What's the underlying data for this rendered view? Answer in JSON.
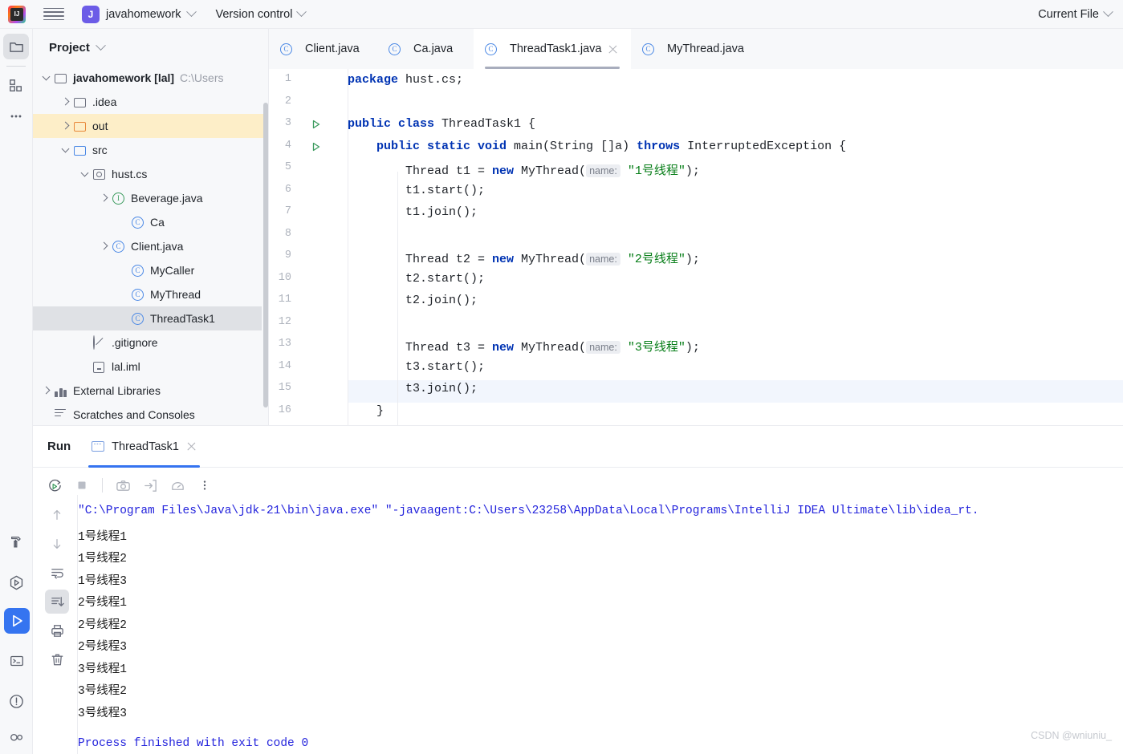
{
  "topbar": {
    "logo_alt": "IntelliJ IDEA",
    "project_initial": "J",
    "project_name": "javahomework",
    "version_control": "Version control",
    "current_file": "Current File"
  },
  "rail": {
    "top_items": [
      {
        "name": "project-tool-window",
        "icon": "folder-icon"
      },
      {
        "name": "commit-tool-window",
        "icon": "modules-icon"
      },
      {
        "name": "more-tool-windows",
        "icon": "ellipsis-icon"
      }
    ],
    "bottom_items": [
      {
        "name": "build-tool-window",
        "icon": "hammer-icon"
      },
      {
        "name": "services-tool-window",
        "icon": "run-anything-icon"
      },
      {
        "name": "run-tool-window",
        "icon": "play-icon"
      },
      {
        "name": "terminal-tool-window",
        "icon": "terminal-icon"
      },
      {
        "name": "problems-tool-window",
        "icon": "warning-icon"
      },
      {
        "name": "profiler-tool-window",
        "icon": "profiler-icon"
      }
    ]
  },
  "project_panel": {
    "title": "Project",
    "tree": [
      {
        "label": "javahomework [lal]",
        "path": "C:\\Users",
        "indent": 0,
        "arrow": "down",
        "icon": "project-folder-icon",
        "bold": true
      },
      {
        "label": ".idea",
        "indent": 1,
        "arrow": "right",
        "icon": "folder-icon"
      },
      {
        "label": "out",
        "indent": 1,
        "arrow": "right",
        "icon": "folder-orange-icon",
        "state": "hover"
      },
      {
        "label": "src",
        "indent": 1,
        "arrow": "down",
        "icon": "folder-blue-icon"
      },
      {
        "label": "hust.cs",
        "indent": 2,
        "arrow": "down",
        "icon": "package-icon"
      },
      {
        "label": "Beverage.java",
        "indent": 3,
        "arrow": "right",
        "icon": "interface-icon"
      },
      {
        "label": "Ca",
        "indent": 4,
        "arrow": "none",
        "icon": "class-icon"
      },
      {
        "label": "Client.java",
        "indent": 3,
        "arrow": "right",
        "icon": "class-icon"
      },
      {
        "label": "MyCaller",
        "indent": 4,
        "arrow": "none",
        "icon": "class-icon"
      },
      {
        "label": "MyThread",
        "indent": 4,
        "arrow": "none",
        "icon": "class-icon"
      },
      {
        "label": "ThreadTask1",
        "indent": 4,
        "arrow": "none",
        "icon": "class-icon",
        "state": "selected"
      },
      {
        "label": ".gitignore",
        "indent": 2,
        "arrow": "none",
        "icon": "gitignore-icon"
      },
      {
        "label": "lal.iml",
        "indent": 2,
        "arrow": "none",
        "icon": "iml-icon"
      },
      {
        "label": "External Libraries",
        "indent": 0,
        "arrow": "right",
        "icon": "libraries-icon"
      },
      {
        "label": "Scratches and Consoles",
        "indent": 0,
        "arrow": "none",
        "icon": "scratches-icon"
      }
    ]
  },
  "editor": {
    "tabs": [
      {
        "label": "Client.java",
        "icon": "class-icon",
        "active": false
      },
      {
        "label": "Ca.java",
        "icon": "class-icon",
        "active": false
      },
      {
        "label": "ThreadTask1.java",
        "icon": "class-icon",
        "active": true,
        "closable": true
      },
      {
        "label": "MyThread.java",
        "icon": "class-icon",
        "active": false
      }
    ],
    "current_line": 15,
    "gutter_run_marks": [
      3,
      4
    ],
    "lines": [
      {
        "n": 1,
        "segments": [
          {
            "t": "package ",
            "c": "kw"
          },
          {
            "t": "hust.cs;",
            "c": ""
          }
        ]
      },
      {
        "n": 2,
        "segments": []
      },
      {
        "n": 3,
        "segments": [
          {
            "t": "public class ",
            "c": "kw"
          },
          {
            "t": "ThreadTask1 {",
            "c": ""
          }
        ]
      },
      {
        "n": 4,
        "segments": [
          {
            "t": "    ",
            "c": ""
          },
          {
            "t": "public static void ",
            "c": "kw"
          },
          {
            "t": "main(String []a) ",
            "c": ""
          },
          {
            "t": "throws ",
            "c": "kw"
          },
          {
            "t": "InterruptedException {",
            "c": ""
          }
        ]
      },
      {
        "n": 5,
        "segments": [
          {
            "t": "        Thread t1 = ",
            "c": ""
          },
          {
            "t": "new ",
            "c": "kw"
          },
          {
            "t": "MyThread(",
            "c": ""
          },
          {
            "t": "name:",
            "c": "hint"
          },
          {
            "t": " ",
            "c": ""
          },
          {
            "t": "\"1号线程\"",
            "c": "str"
          },
          {
            "t": ");",
            "c": ""
          }
        ]
      },
      {
        "n": 6,
        "segments": [
          {
            "t": "        t1.start();",
            "c": ""
          }
        ]
      },
      {
        "n": 7,
        "segments": [
          {
            "t": "        t1.join();",
            "c": ""
          }
        ]
      },
      {
        "n": 8,
        "segments": []
      },
      {
        "n": 9,
        "segments": [
          {
            "t": "        Thread t2 = ",
            "c": ""
          },
          {
            "t": "new ",
            "c": "kw"
          },
          {
            "t": "MyThread(",
            "c": ""
          },
          {
            "t": "name:",
            "c": "hint"
          },
          {
            "t": " ",
            "c": ""
          },
          {
            "t": "\"2号线程\"",
            "c": "str"
          },
          {
            "t": ");",
            "c": ""
          }
        ]
      },
      {
        "n": 10,
        "segments": [
          {
            "t": "        t2.start();",
            "c": ""
          }
        ]
      },
      {
        "n": 11,
        "segments": [
          {
            "t": "        t2.join();",
            "c": ""
          }
        ]
      },
      {
        "n": 12,
        "segments": []
      },
      {
        "n": 13,
        "segments": [
          {
            "t": "        Thread t3 = ",
            "c": ""
          },
          {
            "t": "new ",
            "c": "kw"
          },
          {
            "t": "MyThread(",
            "c": ""
          },
          {
            "t": "name:",
            "c": "hint"
          },
          {
            "t": " ",
            "c": ""
          },
          {
            "t": "\"3号线程\"",
            "c": "str"
          },
          {
            "t": ");",
            "c": ""
          }
        ]
      },
      {
        "n": 14,
        "segments": [
          {
            "t": "        t3.start();",
            "c": ""
          }
        ]
      },
      {
        "n": 15,
        "segments": [
          {
            "t": "        t3.join();",
            "c": ""
          }
        ]
      },
      {
        "n": 16,
        "segments": [
          {
            "t": "    }",
            "c": ""
          }
        ]
      }
    ]
  },
  "run_panel": {
    "title": "Run",
    "tab_label": "ThreadTask1",
    "toolbar": [
      {
        "name": "rerun-button",
        "icon": "rerun-icon"
      },
      {
        "name": "stop-button",
        "icon": "stop-icon"
      },
      {
        "name": "screenshot-button",
        "icon": "camera-icon"
      },
      {
        "name": "dump-threads-button",
        "icon": "export-icon"
      },
      {
        "name": "profiler-button",
        "icon": "gauge-icon"
      },
      {
        "name": "more-options-button",
        "icon": "kebab-icon"
      }
    ],
    "console_rail": [
      {
        "name": "scroll-up-button",
        "icon": "arrow-up-icon"
      },
      {
        "name": "scroll-down-button",
        "icon": "arrow-down-icon"
      },
      {
        "name": "soft-wrap-button",
        "icon": "soft-wrap-icon"
      },
      {
        "name": "scroll-to-end-button",
        "icon": "scroll-to-end-icon",
        "state": "selected"
      },
      {
        "name": "print-button",
        "icon": "printer-icon"
      },
      {
        "name": "clear-all-button",
        "icon": "trash-icon"
      }
    ],
    "console_command": "\"C:\\Program Files\\Java\\jdk-21\\bin\\java.exe\" \"-javaagent:C:\\Users\\23258\\AppData\\Local\\Programs\\IntelliJ IDEA Ultimate\\lib\\idea_rt.",
    "console_output": [
      "1号线程1",
      "1号线程2",
      "1号线程3",
      "2号线程1",
      "2号线程2",
      "2号线程3",
      "3号线程1",
      "3号线程2",
      "3号线程3"
    ],
    "console_footer": "Process finished with exit code 0"
  },
  "watermark": "CSDN @wniuniu_",
  "colors": {
    "accent_blue": "#3574f0",
    "keyword": "#0033b3",
    "string": "#067d17",
    "panel_bg": "#f7f8fa",
    "highlight_yellow": "#fdeec8",
    "selection_gray": "#dfe1e5"
  }
}
